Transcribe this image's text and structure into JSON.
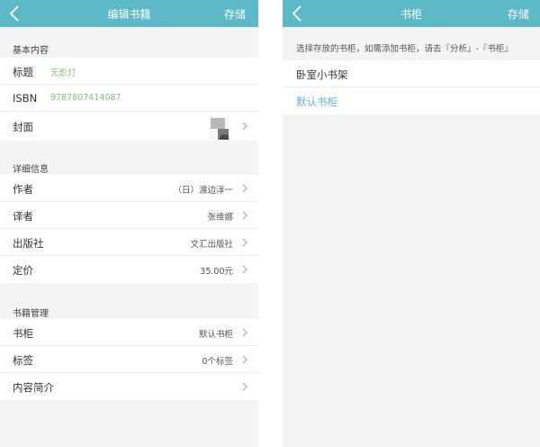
{
  "colors": {
    "accent": "#5db9c7",
    "green_value": "#86c078",
    "link": "#5db9c7"
  },
  "left": {
    "header": {
      "back_icon": "chevron-left-icon",
      "title": "编辑书籍",
      "save_label": "存储"
    },
    "basic": {
      "section_title": "基本内容",
      "title_label": "标题",
      "title_value": "无影灯",
      "isbn_label": "ISBN",
      "isbn_value": "9787807414087",
      "cover_label": "封面"
    },
    "details": {
      "section_title": "详细信息",
      "author_label": "作者",
      "author_value": "（日）渡边淳一",
      "translator_label": "译者",
      "translator_value": "张维娜",
      "publisher_label": "出版社",
      "publisher_value": "文汇出版社",
      "price_label": "定价",
      "price_value": "35.00元"
    },
    "management": {
      "section_title": "书籍管理",
      "shelf_label": "书柜",
      "shelf_value": "默认书柜",
      "tags_label": "标签",
      "tags_value": "0个标签",
      "intro_label": "内容简介"
    }
  },
  "right": {
    "header": {
      "back_icon": "chevron-left-icon",
      "title": "书柜",
      "save_label": "存储"
    },
    "hint": "选择存放的书柜，如需添加书柜，请去『分析』-『书柜』",
    "shelves": [
      {
        "label": "卧室小书架",
        "selected": false
      },
      {
        "label": "默认书柜",
        "selected": true
      }
    ]
  }
}
